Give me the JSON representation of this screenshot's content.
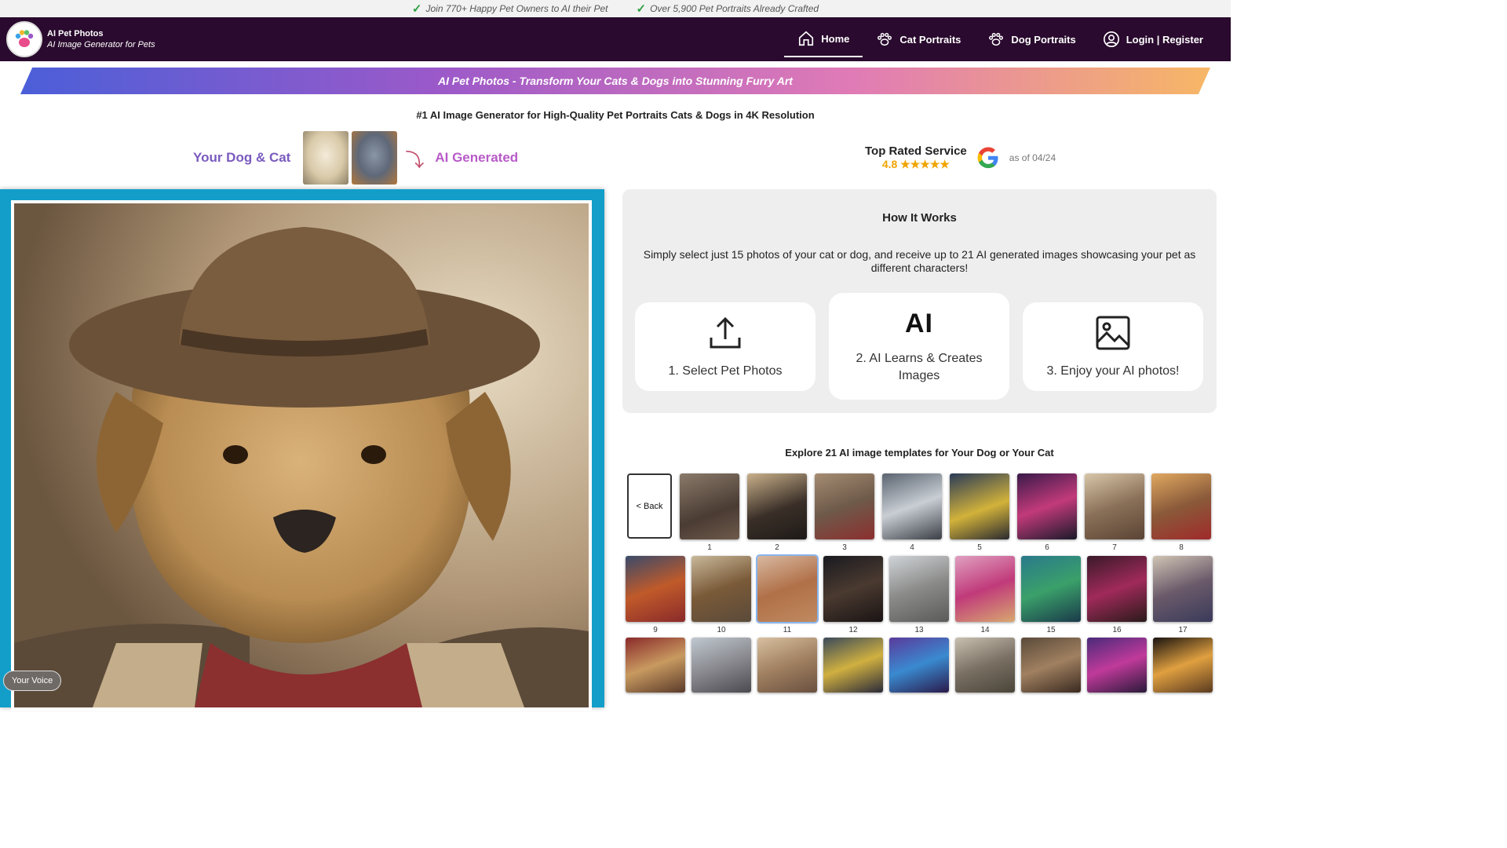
{
  "topbar": {
    "items": [
      "Join 770+ Happy Pet Owners to AI their Pet",
      "Over 5,900 Pet Portraits Already Crafted"
    ]
  },
  "brand": {
    "title": "AI Pet Photos",
    "tagline": "AI Image Generator for Pets"
  },
  "nav": {
    "home": "Home",
    "cat": "Cat Portraits",
    "dog": "Dog Portraits",
    "login": "Login | Register"
  },
  "banner": "AI Pet Photos - Transform Your Cats & Dogs into Stunning Furry Art",
  "subtitle": "#1 AI Image Generator for High-Quality Pet Portraits Cats & Dogs in 4K Resolution",
  "compare": {
    "left": "Your Dog & Cat",
    "right": "AI Generated"
  },
  "rating": {
    "title": "Top Rated Service",
    "score": "4.8 ★★★★★",
    "asof": "as of 04/24"
  },
  "how": {
    "title": "How It Works",
    "desc": "Simply select just 15 photos of your cat or dog, and receive up to 21 AI generated images showcasing your pet as different characters!",
    "steps": [
      "1. Select Pet Photos",
      "2. AI Learns & Creates Images",
      "3. Enjoy your AI photos!"
    ],
    "ai_glyph": "AI"
  },
  "explore": {
    "title": "Explore 21 AI image templates for Your Dog or Your Cat",
    "back": "< Back",
    "numbers": [
      "1",
      "2",
      "3",
      "4",
      "5",
      "6",
      "7",
      "8",
      "9",
      "10",
      "11",
      "12",
      "13",
      "14",
      "15",
      "16",
      "17"
    ]
  },
  "voice": "Your Voice"
}
